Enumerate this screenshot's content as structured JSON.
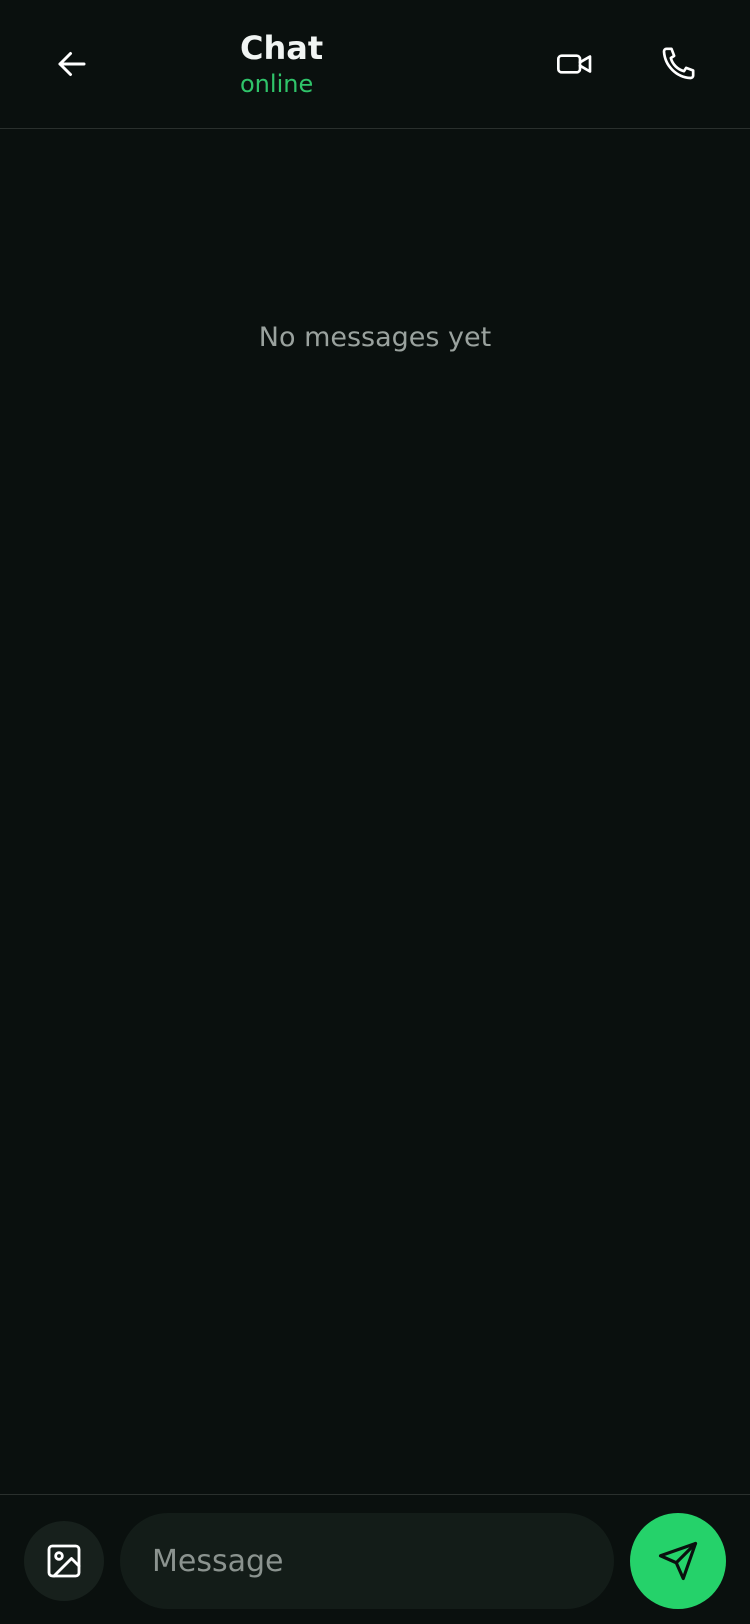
{
  "header": {
    "title": "Chat",
    "status": "online"
  },
  "messages": {
    "empty_text": "No messages yet"
  },
  "composer": {
    "placeholder": "Message",
    "value": ""
  },
  "icons": {
    "back": "arrow-left-icon",
    "video": "video-camera-icon",
    "call": "phone-icon",
    "attach": "image-icon",
    "send": "send-icon"
  },
  "colors": {
    "background": "#0a100e",
    "accent": "#25d26a",
    "status_online": "#2fc46a"
  }
}
